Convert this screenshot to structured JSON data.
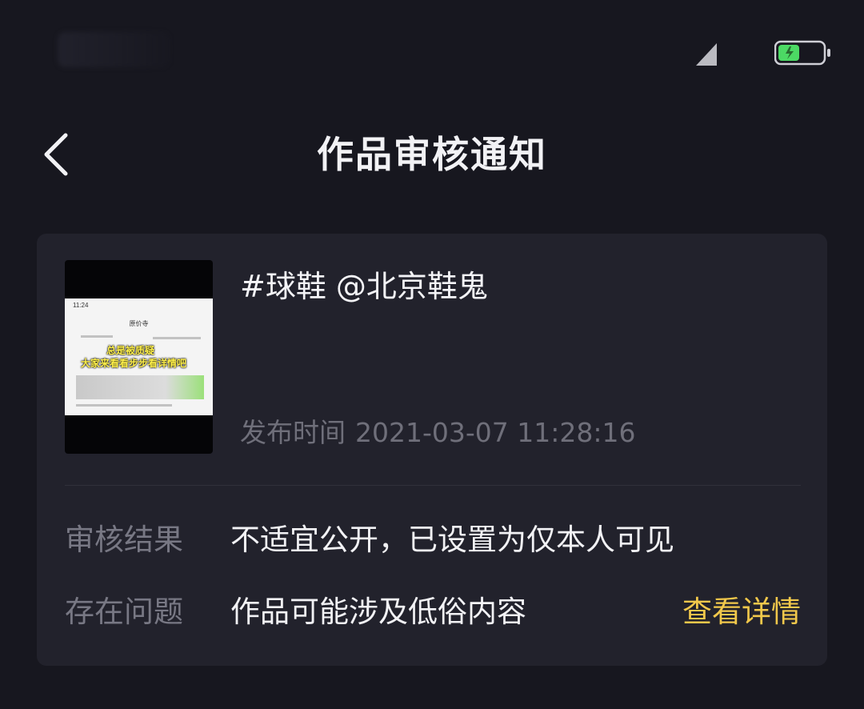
{
  "header": {
    "title": "作品审核通知"
  },
  "post": {
    "title": "#球鞋 @北京鞋鬼",
    "publish_label": "发布时间",
    "publish_time": "2021-03-07 11:28:16",
    "thumbnail": {
      "time": "11:24",
      "screen_title": "原价寺",
      "overlay_line1": "总是被质疑",
      "overlay_line2": "大家来看看步步看详情吧"
    }
  },
  "review": {
    "result_label": "审核结果",
    "result_value": "不适宜公开，已设置为仅本人可见",
    "issue_label": "存在问题",
    "issue_value": "作品可能涉及低俗内容",
    "details_link": "查看详情"
  },
  "colors": {
    "background": "#17171f",
    "card": "#22222c",
    "accent": "#f1c84b",
    "battery_fill": "#4cd964"
  }
}
